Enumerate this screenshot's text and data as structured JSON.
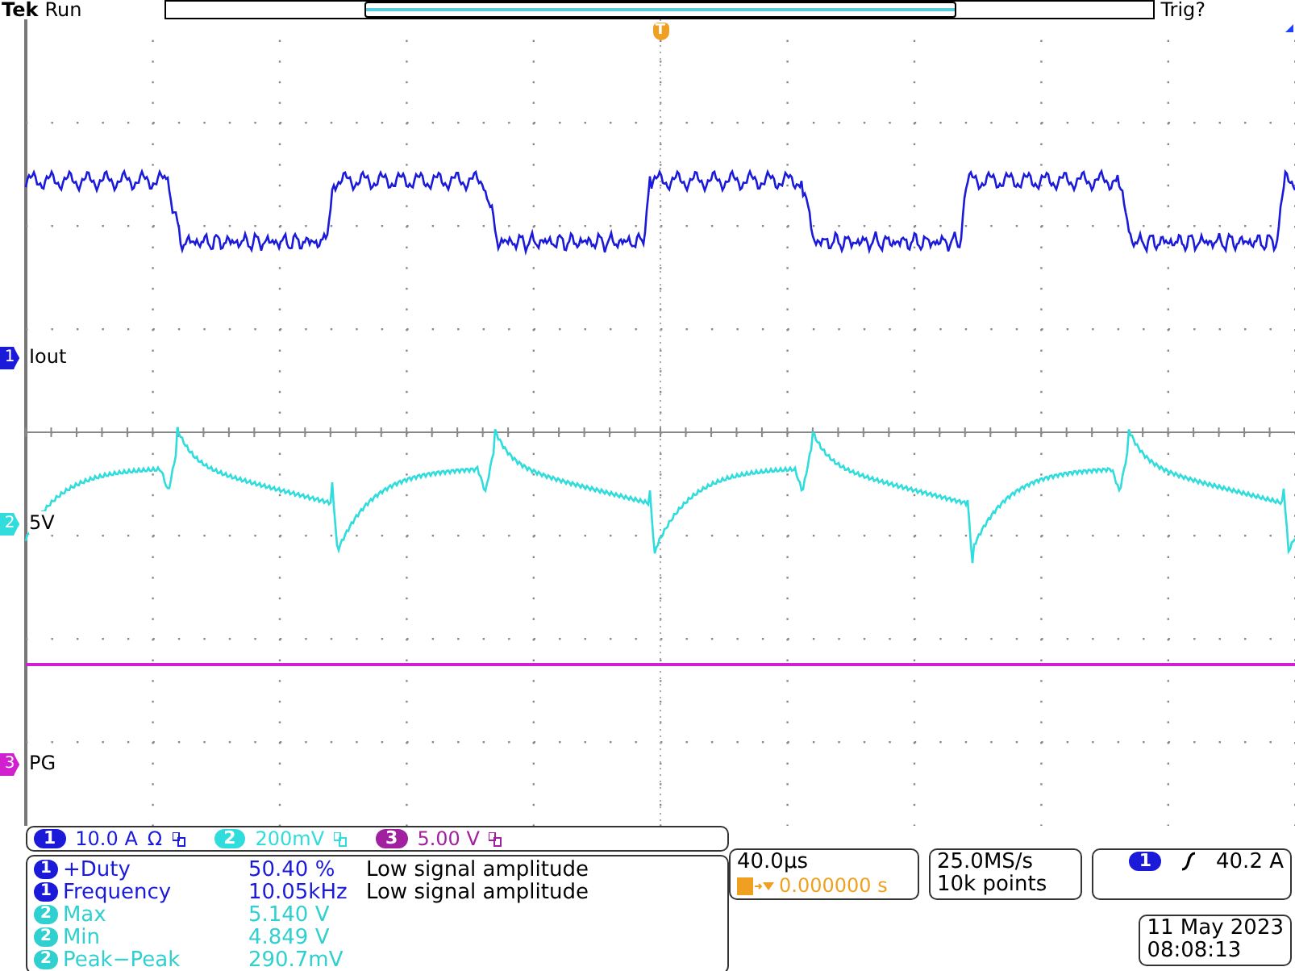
{
  "status": {
    "brand": "Tek",
    "state": "Run",
    "trigger_state": "Trig?"
  },
  "trigger_marker": "T",
  "channels": [
    {
      "number": "1",
      "label": "Iout",
      "color": "#1a1ad8",
      "kind": "square"
    },
    {
      "number": "2",
      "label": "5V",
      "color": "#30dcdc",
      "kind": "sawtooth"
    },
    {
      "number": "3",
      "label": "PG",
      "color": "#d020d0",
      "kind": "flat"
    }
  ],
  "scales": [
    {
      "channel": "1",
      "value": "10.0 A",
      "coupling": "Ω",
      "color": "#1a1ad8"
    },
    {
      "channel": "2",
      "value": "200mV",
      "color": "#30dcdc"
    },
    {
      "channel": "3",
      "value": "5.00 V",
      "color": "#a020a0"
    }
  ],
  "measurements": [
    {
      "channel": "1",
      "name": "+Duty",
      "value": "50.40 %",
      "note": "Low signal amplitude",
      "color": "#1a1ad8"
    },
    {
      "channel": "1",
      "name": "Frequency",
      "value": "10.05kHz",
      "note": "Low signal amplitude",
      "color": "#1a1ad8"
    },
    {
      "channel": "2",
      "name": "Max",
      "value": "5.140 V",
      "color": "#30d0d0"
    },
    {
      "channel": "2",
      "name": "Min",
      "value": "4.849 V",
      "color": "#30d0d0"
    },
    {
      "channel": "2",
      "name": "Peak−Peak",
      "value": "290.7mV",
      "color": "#30d0d0"
    }
  ],
  "horizontal": {
    "scale": "40.0µs",
    "position": "0.000000 s"
  },
  "acquisition": {
    "rate": "25.0MS/s",
    "length": "10k points"
  },
  "trigger": {
    "channel": "1",
    "level": "40.2 A",
    "color": "#1a1ad8"
  },
  "datetime": {
    "date": "11 May 2023",
    "time": "08:08:13"
  }
}
